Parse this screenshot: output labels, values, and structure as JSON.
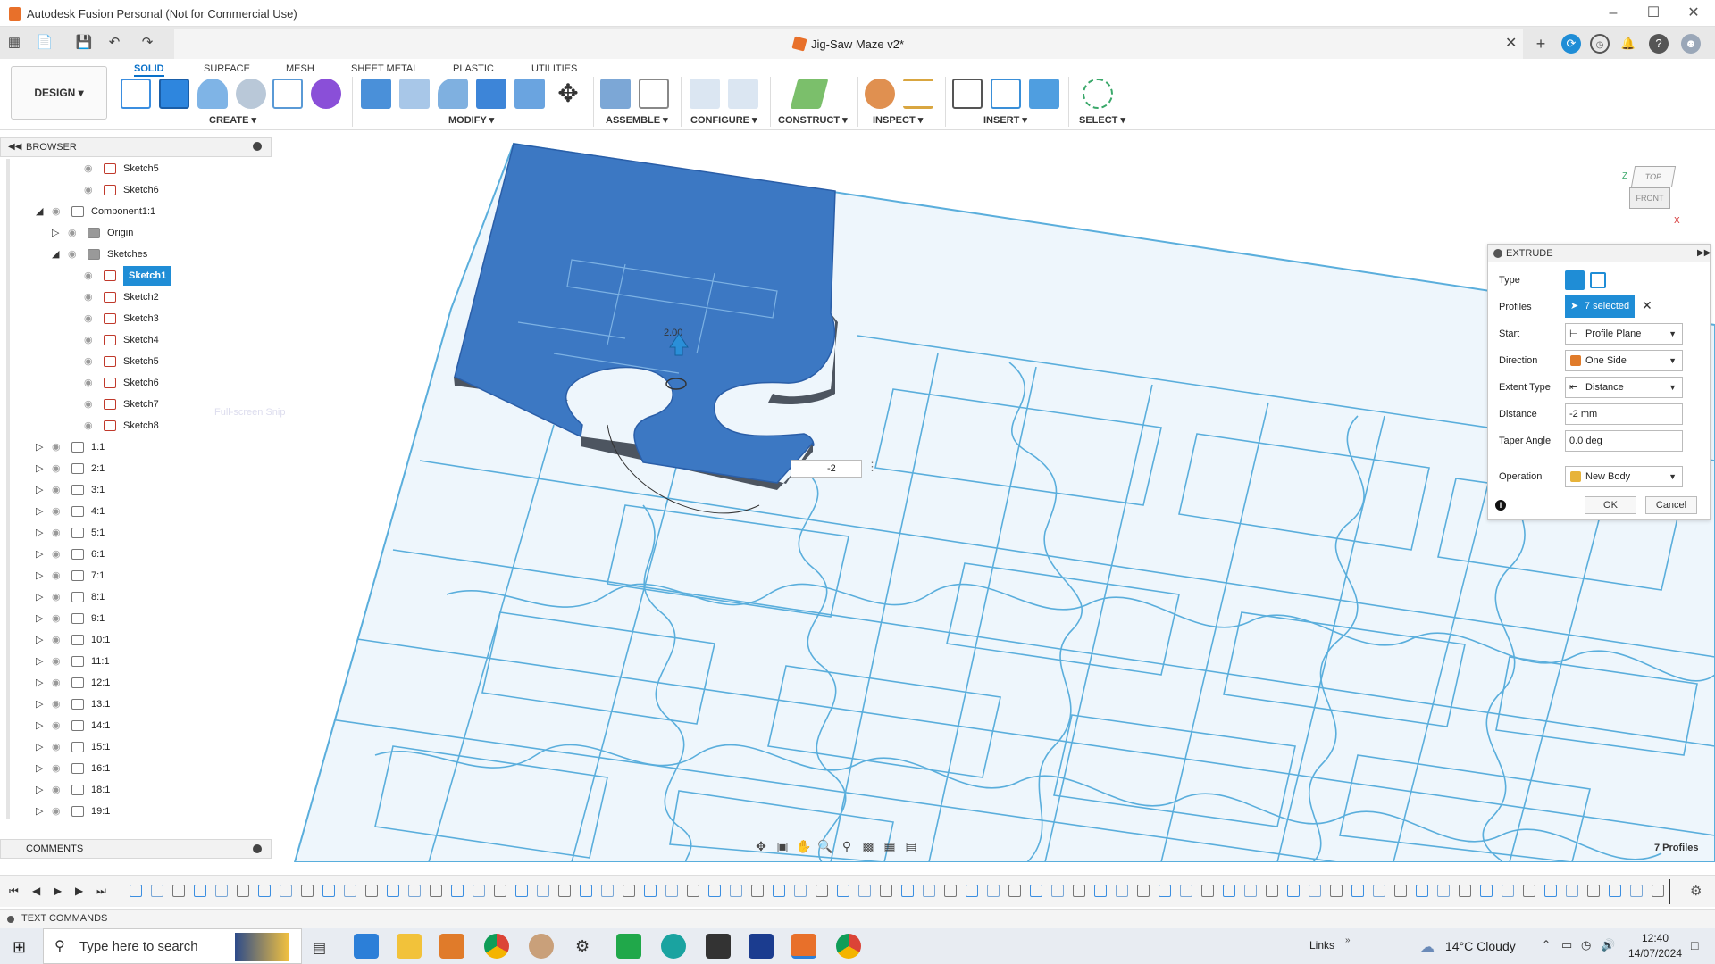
{
  "window": {
    "title": "Autodesk Fusion Personal (Not for Commercial Use)"
  },
  "document": {
    "name": "Jig-Saw Maze v2*"
  },
  "workspace": {
    "label": "DESIGN ▾"
  },
  "toolbar": {
    "tabs": [
      "SOLID",
      "SURFACE",
      "MESH",
      "SHEET METAL",
      "PLASTIC",
      "UTILITIES"
    ],
    "groups": [
      "CREATE ▾",
      "MODIFY ▾",
      "ASSEMBLE ▾",
      "CONFIGURE ▾",
      "CONSTRUCT ▾",
      "INSPECT ▾",
      "INSERT ▾",
      "SELECT ▾"
    ]
  },
  "browser": {
    "title": "BROWSER",
    "items": [
      {
        "label": "Sketch5",
        "indent": 3,
        "type": "sketch",
        "expand": ""
      },
      {
        "label": "Sketch6",
        "indent": 3,
        "type": "sketch",
        "expand": ""
      },
      {
        "label": "Component1:1",
        "indent": 1,
        "type": "component",
        "expand": "open"
      },
      {
        "label": "Origin",
        "indent": 2,
        "type": "folder",
        "expand": "closed"
      },
      {
        "label": "Sketches",
        "indent": 2,
        "type": "folder",
        "expand": "open"
      },
      {
        "label": "Sketch1",
        "indent": 3,
        "type": "sketch",
        "expand": "",
        "selected": true
      },
      {
        "label": "Sketch2",
        "indent": 3,
        "type": "sketch",
        "expand": ""
      },
      {
        "label": "Sketch3",
        "indent": 3,
        "type": "sketch",
        "expand": ""
      },
      {
        "label": "Sketch4",
        "indent": 3,
        "type": "sketch",
        "expand": ""
      },
      {
        "label": "Sketch5",
        "indent": 3,
        "type": "sketch",
        "expand": ""
      },
      {
        "label": "Sketch6",
        "indent": 3,
        "type": "sketch",
        "expand": ""
      },
      {
        "label": "Sketch7",
        "indent": 3,
        "type": "sketch",
        "expand": ""
      },
      {
        "label": "Sketch8",
        "indent": 3,
        "type": "sketch",
        "expand": ""
      },
      {
        "label": "1:1",
        "indent": 1,
        "type": "body",
        "expand": "closed"
      },
      {
        "label": "2:1",
        "indent": 1,
        "type": "body",
        "expand": "closed"
      },
      {
        "label": "3:1",
        "indent": 1,
        "type": "body",
        "expand": "closed"
      },
      {
        "label": "4:1",
        "indent": 1,
        "type": "body",
        "expand": "closed"
      },
      {
        "label": "5:1",
        "indent": 1,
        "type": "body",
        "expand": "closed"
      },
      {
        "label": "6:1",
        "indent": 1,
        "type": "body",
        "expand": "closed"
      },
      {
        "label": "7:1",
        "indent": 1,
        "type": "body",
        "expand": "closed"
      },
      {
        "label": "8:1",
        "indent": 1,
        "type": "body",
        "expand": "closed"
      },
      {
        "label": "9:1",
        "indent": 1,
        "type": "body",
        "expand": "closed"
      },
      {
        "label": "10:1",
        "indent": 1,
        "type": "body",
        "expand": "closed"
      },
      {
        "label": "11:1",
        "indent": 1,
        "type": "body",
        "expand": "closed"
      },
      {
        "label": "12:1",
        "indent": 1,
        "type": "body",
        "expand": "closed"
      },
      {
        "label": "13:1",
        "indent": 1,
        "type": "body",
        "expand": "closed"
      },
      {
        "label": "14:1",
        "indent": 1,
        "type": "body",
        "expand": "closed"
      },
      {
        "label": "15:1",
        "indent": 1,
        "type": "body",
        "expand": "closed"
      },
      {
        "label": "16:1",
        "indent": 1,
        "type": "body",
        "expand": "closed"
      },
      {
        "label": "18:1",
        "indent": 1,
        "type": "body",
        "expand": "closed"
      },
      {
        "label": "19:1",
        "indent": 1,
        "type": "body",
        "expand": "closed"
      }
    ],
    "ghost_tooltip": "Full-screen Snip"
  },
  "comments": {
    "title": "COMMENTS"
  },
  "viewcube": {
    "top": "TOP",
    "front": "FRONT",
    "x_axis": "X",
    "z_axis": "Z"
  },
  "extrude": {
    "title": "EXTRUDE",
    "fields": {
      "type_label": "Type",
      "profiles_label": "Profiles",
      "profiles_value": "7 selected",
      "start_label": "Start",
      "start_value": "Profile Plane",
      "direction_label": "Direction",
      "direction_value": "One Side",
      "extent_label": "Extent Type",
      "extent_value": "Distance",
      "distance_label": "Distance",
      "distance_value": "-2 mm",
      "taper_label": "Taper Angle",
      "taper_value": "0.0 deg",
      "operation_label": "Operation",
      "operation_value": "New Body"
    },
    "ok": "OK",
    "cancel": "Cancel"
  },
  "canvas": {
    "input_value": "-2",
    "dimension": "2.00",
    "profiles_count": "7 Profiles"
  },
  "text_commands": {
    "label": "TEXT COMMANDS"
  },
  "taskbar": {
    "search_placeholder": "Type here to search",
    "links": "Links",
    "weather": "14°C  Cloudy",
    "time": "12:40",
    "date": "14/07/2024"
  },
  "colors": {
    "accent": "#0a71c9",
    "selected_profile": "#3c78c3",
    "sketch_lines": "#5aaedc",
    "plate": "#eef6fc"
  }
}
